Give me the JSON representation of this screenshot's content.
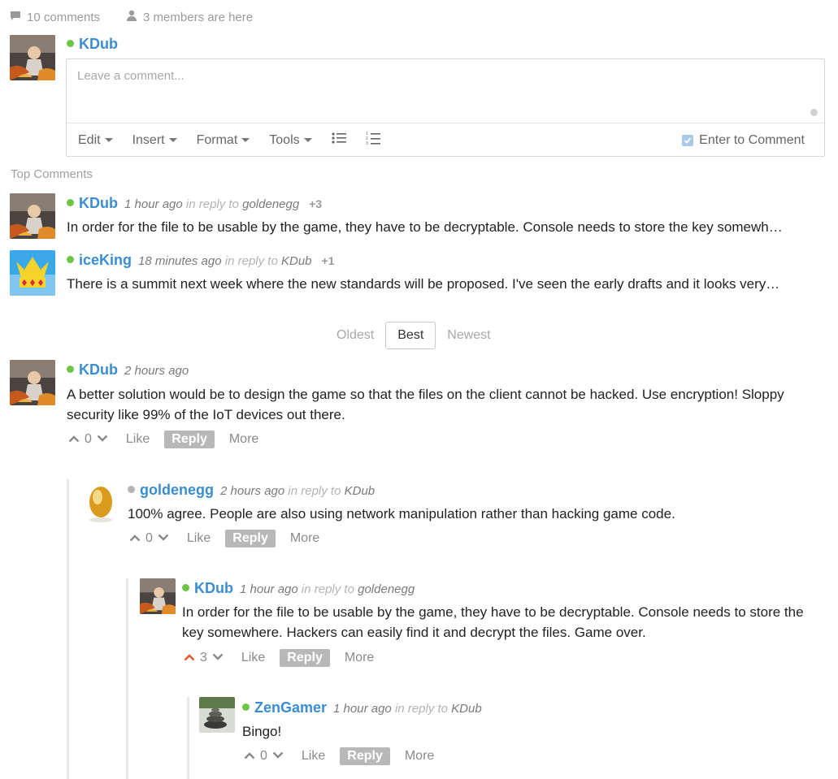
{
  "topbar": {
    "comments": "10 comments",
    "members": "3 members are here"
  },
  "composer": {
    "user": "KDub",
    "placeholder": "Leave a comment...",
    "menu": [
      "Edit",
      "Insert",
      "Format",
      "Tools"
    ],
    "enter_label": "Enter to Comment"
  },
  "top_comments": {
    "label": "Top Comments",
    "items": [
      {
        "user": "KDub",
        "time": "1 hour ago",
        "reply_label": "in reply to",
        "reply_to": "goldenegg",
        "score": "+3",
        "text": "In order for the file to be usable by the game, they have to be decryptable. Console needs to store the key somewh…"
      },
      {
        "user": "iceKing",
        "time": "18 minutes ago",
        "reply_label": "in reply to",
        "reply_to": "KDub",
        "score": "+1",
        "text": "There is a summit next week where the new standards will be proposed. I've seen the early drafts and it looks very…"
      }
    ]
  },
  "sort": {
    "oldest": "Oldest",
    "best": "Best",
    "newest": "Newest"
  },
  "thread": [
    {
      "user": "KDub",
      "time": "2 hours ago",
      "reply_label": "",
      "reply_to": "",
      "text": "A better solution would be to design the game so that the files on the client cannot be hacked. Use encryption! Sloppy security like 99% of the IoT devices out there.",
      "votes": "0",
      "like": "Like",
      "reply": "Reply",
      "more": "More"
    },
    {
      "user": "goldenegg",
      "time": "2 hours ago",
      "reply_label": "in reply to",
      "reply_to": "KDub",
      "text": "100% agree. People are also using network manipulation rather than hacking game code.",
      "votes": "0",
      "like": "Like",
      "reply": "Reply",
      "more": "More"
    },
    {
      "user": "KDub",
      "time": "1 hour ago",
      "reply_label": "in reply to",
      "reply_to": "goldenegg",
      "text": "In order for the file to be usable by the game, they have to be decryptable. Console needs to store the key somewhere. Hackers can easily find it and decrypt the files. Game over.",
      "votes": "3",
      "like": "Like",
      "reply": "Reply",
      "more": "More"
    },
    {
      "user": "ZenGamer",
      "time": "1 hour ago",
      "reply_label": "in reply to",
      "reply_to": "KDub",
      "text": "Bingo!",
      "votes": "0",
      "like": "Like",
      "reply": "Reply",
      "more": "More"
    }
  ],
  "colors": {
    "accent": "#3b8dd1",
    "online": "#6cc644",
    "upvoted": "#e8562a"
  }
}
